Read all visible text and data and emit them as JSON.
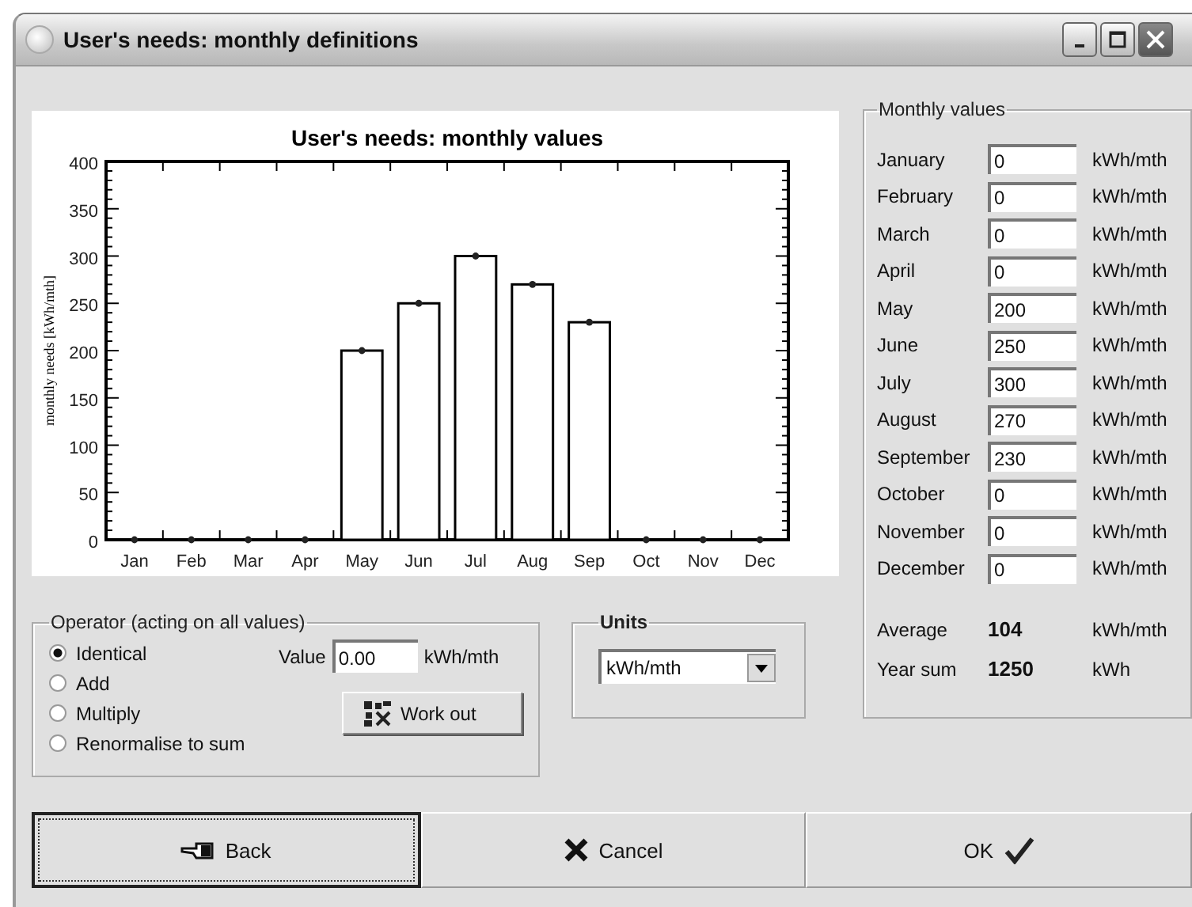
{
  "window": {
    "title": "User's needs: monthly definitions"
  },
  "chart": {
    "chart_data": {
      "type": "bar",
      "title": "User's needs: monthly values",
      "ylabel": "monthly needs  [kWh/mth]",
      "categories": [
        "Jan",
        "Feb",
        "Mar",
        "Apr",
        "May",
        "Jun",
        "Jul",
        "Aug",
        "Sep",
        "Oct",
        "Nov",
        "Dec"
      ],
      "values": [
        0,
        0,
        0,
        0,
        200,
        250,
        300,
        270,
        230,
        0,
        0,
        0
      ],
      "ylim": [
        0,
        400
      ],
      "yticks": [
        0,
        50,
        100,
        150,
        200,
        250,
        300,
        350,
        400
      ]
    }
  },
  "monthly_values": {
    "legend": "Monthly values",
    "rows": [
      {
        "month": "January",
        "value": "0",
        "unit": "kWh/mth"
      },
      {
        "month": "February",
        "value": "0",
        "unit": "kWh/mth"
      },
      {
        "month": "March",
        "value": "0",
        "unit": "kWh/mth"
      },
      {
        "month": "April",
        "value": "0",
        "unit": "kWh/mth"
      },
      {
        "month": "May",
        "value": "200",
        "unit": "kWh/mth"
      },
      {
        "month": "June",
        "value": "250",
        "unit": "kWh/mth"
      },
      {
        "month": "July",
        "value": "300",
        "unit": "kWh/mth"
      },
      {
        "month": "August",
        "value": "270",
        "unit": "kWh/mth"
      },
      {
        "month": "September",
        "value": "230",
        "unit": "kWh/mth"
      },
      {
        "month": "October",
        "value": "0",
        "unit": "kWh/mth"
      },
      {
        "month": "November",
        "value": "0",
        "unit": "kWh/mth"
      },
      {
        "month": "December",
        "value": "0",
        "unit": "kWh/mth"
      }
    ],
    "totals": [
      {
        "label": "Average",
        "value": "104",
        "unit": "kWh/mth"
      },
      {
        "label": "Year sum",
        "value": "1250",
        "unit": "kWh"
      }
    ]
  },
  "operator": {
    "legend": "Operator  (acting on all values)",
    "options": [
      {
        "label": "Identical",
        "selected": true
      },
      {
        "label": "Add",
        "selected": false
      },
      {
        "label": "Multiply",
        "selected": false
      },
      {
        "label": "Renormalise to sum",
        "selected": false
      }
    ],
    "value_label": "Value",
    "value": "0.00",
    "value_unit": "kWh/mth",
    "work_out_button": "Work out"
  },
  "units": {
    "legend": "Units",
    "value": "kWh/mth"
  },
  "buttons": [
    {
      "label": "Back",
      "kind": "back"
    },
    {
      "label": "Cancel",
      "kind": "cancel"
    },
    {
      "label": "OK",
      "kind": "ok"
    }
  ]
}
